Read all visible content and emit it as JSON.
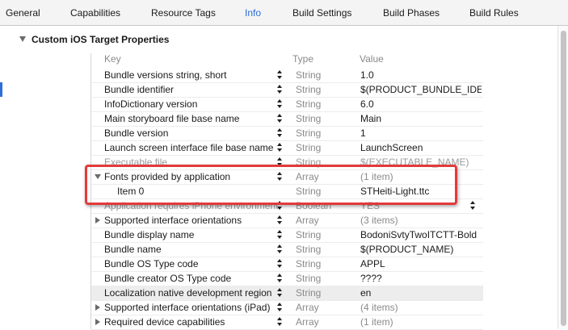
{
  "tabs": [
    {
      "label": "General",
      "active": false
    },
    {
      "label": "Capabilities",
      "active": false
    },
    {
      "label": "Resource Tags",
      "active": false
    },
    {
      "label": "Info",
      "active": true
    },
    {
      "label": "Build Settings",
      "active": false
    },
    {
      "label": "Build Phases",
      "active": false
    },
    {
      "label": "Build Rules",
      "active": false
    }
  ],
  "section": {
    "title": "Custom iOS Target Properties"
  },
  "columns": {
    "key": "Key",
    "type": "Type",
    "value": "Value"
  },
  "rows": [
    {
      "key": "Bundle versions string, short",
      "type": "String",
      "value": "1.0"
    },
    {
      "key": "Bundle identifier",
      "type": "String",
      "value": "$(PRODUCT_BUNDLE_IDEN"
    },
    {
      "key": "InfoDictionary version",
      "type": "String",
      "value": "6.0"
    },
    {
      "key": "Main storyboard file base name",
      "type": "String",
      "value": "Main"
    },
    {
      "key": "Bundle version",
      "type": "String",
      "value": "1"
    },
    {
      "key": "Launch screen interface file base name",
      "type": "String",
      "value": "LaunchScreen"
    },
    {
      "key": "Executable file",
      "type": "String",
      "value": "$(EXECUTABLE_NAME)"
    },
    {
      "key": "Fonts provided by application",
      "type": "Array",
      "value": "(1 item)"
    },
    {
      "key": "Item 0",
      "type": "String",
      "value": "STHeiti-Light.ttc"
    },
    {
      "key": "Application requires iPhone environment",
      "type": "Boolean",
      "value": "YES"
    },
    {
      "key": "Supported interface orientations",
      "type": "Array",
      "value": "(3 items)"
    },
    {
      "key": "Bundle display name",
      "type": "String",
      "value": "BodoniSvtyTwoITCTT-Bold"
    },
    {
      "key": "Bundle name",
      "type": "String",
      "value": "$(PRODUCT_NAME)"
    },
    {
      "key": "Bundle OS Type code",
      "type": "String",
      "value": "APPL"
    },
    {
      "key": "Bundle creator OS Type code",
      "type": "String",
      "value": "????"
    },
    {
      "key": "Localization native development region",
      "type": "String",
      "value": "en"
    },
    {
      "key": "Supported interface orientations (iPad)",
      "type": "Array",
      "value": "(4 items)"
    },
    {
      "key": "Required device capabilities",
      "type": "Array",
      "value": "(1 item)"
    }
  ],
  "colors": {
    "accent": "#2a6fd6",
    "highlight": "#e23a3a"
  }
}
